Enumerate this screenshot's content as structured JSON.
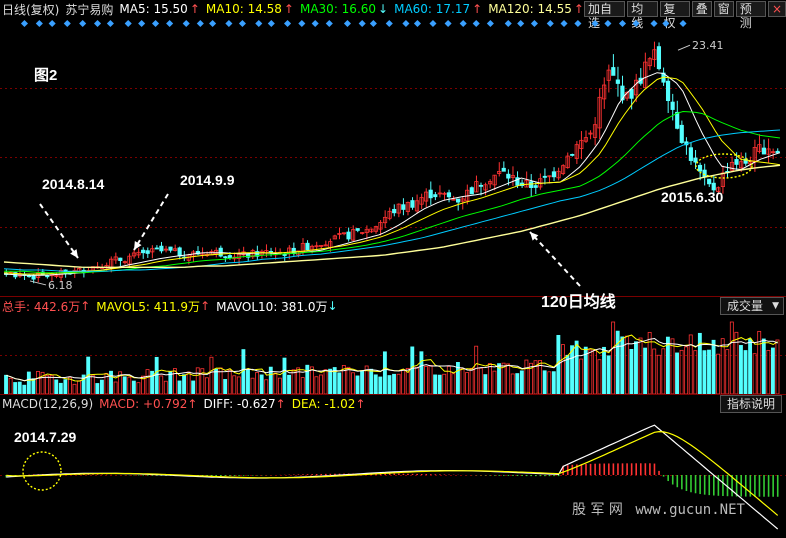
{
  "header": {
    "chart_mode": "日线(复权)",
    "stock_name": "苏宁易购",
    "ma": [
      {
        "label": "MA5: 15.50",
        "arrow": "↑",
        "color": "#ffffff"
      },
      {
        "label": "MA10: 14.58",
        "arrow": "↑",
        "color": "#ffff00"
      },
      {
        "label": "MA30: 16.60",
        "arrow": "↓",
        "color": "#00ff00"
      },
      {
        "label": "MA60: 17.17",
        "arrow": "↑",
        "color": "#00ccff"
      },
      {
        "label": "MA120: 14.55",
        "arrow": "↑",
        "color": "#ffff99"
      }
    ],
    "toolbar": [
      "加自选",
      "均线",
      "复权",
      "叠",
      "窗",
      "预测"
    ],
    "close_symbol": "×"
  },
  "annotations": {
    "figure_label": "图2",
    "date1": "2014.8.14",
    "date2": "2014.9.9",
    "date3": "2015.6.30",
    "ma120_note": "120日均线",
    "macd_date": "2014.7.29",
    "high_label": "23.41",
    "low_label": "6.18"
  },
  "volume_header": {
    "total": "总手: 442.6万",
    "total_arrow": "↑",
    "mavol5": "MAVOL5: 411.9万",
    "mavol5_arrow": "↑",
    "mavol10": "MAVOL10: 381.0万",
    "mavol10_arrow": "↓",
    "selector": "成交量"
  },
  "macd_header": {
    "name": "MACD(12,26,9)",
    "macd": "MACD: +0.792",
    "macd_arrow": "↑",
    "diff": "DIFF: -0.627",
    "diff_arrow": "↑",
    "dea": "DEA: -1.02",
    "dea_arrow": "↑",
    "help": "指标说明"
  },
  "watermark": {
    "text": "股 军 网",
    "url": "www.gucun.NET"
  },
  "colors": {
    "up": "#ff3232",
    "down": "#54ffff",
    "ma5": "#ffffff",
    "ma10": "#ffff00",
    "ma30": "#00ff00",
    "ma60": "#00ccff",
    "ma120": "#ffff99",
    "grid": "#7a0000"
  },
  "chart_data": {
    "type": "candlestick",
    "title": "苏宁易购 日线(复权)",
    "price_range": [
      5.5,
      25.0
    ],
    "price_markers": {
      "high": 23.41,
      "low": 6.18
    },
    "close_series": [
      6.5,
      6.4,
      6.3,
      6.2,
      6.25,
      6.3,
      6.4,
      6.5,
      6.6,
      6.8,
      7.0,
      7.2,
      7.4,
      7.5,
      7.7,
      7.8,
      8.0,
      8.1,
      8.1,
      8.0,
      7.9,
      7.9,
      8.0,
      8.1,
      8.0,
      7.9,
      7.8,
      7.8,
      7.9,
      8.0,
      8.1,
      8.0,
      8.1,
      8.3,
      8.5,
      8.7,
      8.9,
      9.0,
      9.2,
      9.4,
      9.6,
      9.8,
      10.2,
      10.8,
      11.3,
      11.5,
      11.8,
      12.2,
      12.5,
      12.3,
      12.1,
      12.0,
      12.5,
      13.0,
      13.5,
      13.8,
      14.0,
      13.6,
      13.2,
      13.0,
      13.2,
      13.5,
      14.2,
      15.0,
      15.8,
      16.4,
      17.0,
      19.5,
      21.5,
      20.5,
      19.5,
      20.5,
      21.8,
      22.8,
      21.5,
      19.2,
      17.0,
      15.5,
      14.2,
      13.0,
      12.8,
      14.0,
      15.0,
      14.5,
      15.2,
      15.8,
      16.0,
      15.5
    ],
    "ma_series": {
      "MA5": [
        6.4,
        6.3,
        6.3,
        6.4,
        6.5,
        6.7,
        7.0,
        7.3,
        7.6,
        7.8,
        8.0,
        8.0,
        7.9,
        8.0,
        7.9,
        8.0,
        8.2,
        8.6,
        9.0,
        9.4,
        10.2,
        11.2,
        11.9,
        12.2,
        12.4,
        13.0,
        13.6,
        13.2,
        13.3,
        14.5,
        16.5,
        19.5,
        21.0,
        21.6,
        20.5,
        17.2,
        14.5,
        14.2,
        15.0,
        15.5
      ],
      "MA10": [
        6.5,
        6.4,
        6.4,
        6.5,
        6.6,
        6.7,
        6.9,
        7.1,
        7.4,
        7.6,
        7.8,
        7.9,
        8.0,
        8.0,
        8.0,
        8.1,
        8.3,
        8.5,
        8.8,
        9.2,
        9.8,
        10.5,
        11.2,
        11.7,
        12.1,
        12.6,
        13.1,
        13.2,
        13.3,
        14.0,
        15.5,
        18.0,
        20.0,
        21.2,
        21.0,
        19.0,
        16.5,
        15.0,
        14.8,
        14.6
      ],
      "MA30": [
        6.6,
        6.6,
        6.5,
        6.5,
        6.5,
        6.6,
        6.7,
        6.9,
        7.0,
        7.2,
        7.4,
        7.5,
        7.7,
        7.8,
        7.9,
        8.0,
        8.1,
        8.3,
        8.5,
        8.8,
        9.2,
        9.7,
        10.2,
        10.7,
        11.1,
        11.5,
        12.0,
        12.4,
        12.7,
        13.0,
        13.8,
        15.0,
        16.5,
        17.8,
        18.6,
        18.5,
        17.8,
        17.2,
        16.8,
        16.6
      ],
      "MA60": [
        6.8,
        6.7,
        6.7,
        6.6,
        6.6,
        6.6,
        6.7,
        6.7,
        6.8,
        6.9,
        7.0,
        7.2,
        7.3,
        7.5,
        7.6,
        7.8,
        7.9,
        8.1,
        8.3,
        8.5,
        8.8,
        9.1,
        9.5,
        9.9,
        10.3,
        10.7,
        11.1,
        11.5,
        11.9,
        12.2,
        12.7,
        13.4,
        14.3,
        15.2,
        16.0,
        16.5,
        16.8,
        17.0,
        17.1,
        17.2
      ],
      "MA120": [
        7.3,
        7.2,
        7.1,
        7.0,
        6.9,
        6.9,
        6.9,
        6.9,
        6.9,
        6.9,
        7.0,
        7.0,
        7.1,
        7.2,
        7.3,
        7.4,
        7.5,
        7.6,
        7.7,
        7.8,
        8.0,
        8.2,
        8.4,
        8.7,
        9.0,
        9.3,
        9.6,
        10.0,
        10.4,
        10.8,
        11.3,
        11.8,
        12.3,
        12.8,
        13.2,
        13.6,
        13.9,
        14.2,
        14.4,
        14.55
      ]
    },
    "volume": {
      "unit": "万手",
      "latest": 442.6,
      "mavol5": 411.9,
      "mavol10": 381.0
    },
    "macd": {
      "params": [
        12,
        26,
        9
      ],
      "macd": 0.792,
      "diff": -0.627,
      "dea": -1.02,
      "zero_line": 0
    },
    "annotations": [
      "2014.8.14",
      "2014.9.9",
      "2015.6.30",
      "120日均线",
      "2014.7.29"
    ]
  }
}
